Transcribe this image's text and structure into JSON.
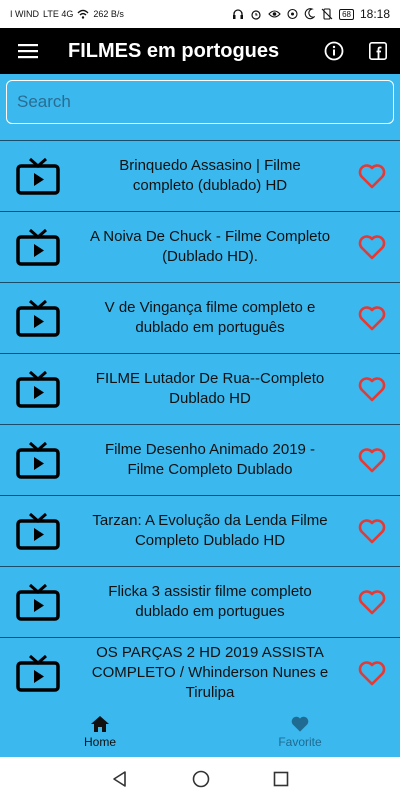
{
  "statusbar": {
    "carrier": "I WIND",
    "net_type": "LTE 4G",
    "speed": "262 B/s",
    "battery": "68",
    "time": "18:18"
  },
  "appbar": {
    "title": "FILMES em portogues"
  },
  "search": {
    "placeholder": "Search",
    "value": ""
  },
  "list": {
    "items": [
      {
        "title": "Brinquedo Assasino | Filme\ncompleto (dublado) HD"
      },
      {
        "title": "A Noiva De Chuck - Filme Completo\n(Dublado HD)."
      },
      {
        "title": "V de Vingança filme completo e\ndublado em português"
      },
      {
        "title": "FILME Lutador De Rua--Completo\nDublado HD"
      },
      {
        "title": "Filme Desenho Animado  2019 -\nFilme Completo Dublado"
      },
      {
        "title": "Tarzan: A Evolução da Lenda Filme\nCompleto Dublado HD"
      },
      {
        "title": "Flicka 3  assistir filme completo\ndublado em portugues"
      },
      {
        "title": "OS PARÇAS 2 HD 2019 ASSISTA\nCOMPLETO / Whinderson Nunes e\nTirulipa"
      }
    ]
  },
  "bottomnav": {
    "home_label": "Home",
    "favorite_label": "Favorite"
  },
  "colors": {
    "background": "#3bb8ee",
    "appbar": "#000000",
    "heart": "#e53935"
  }
}
